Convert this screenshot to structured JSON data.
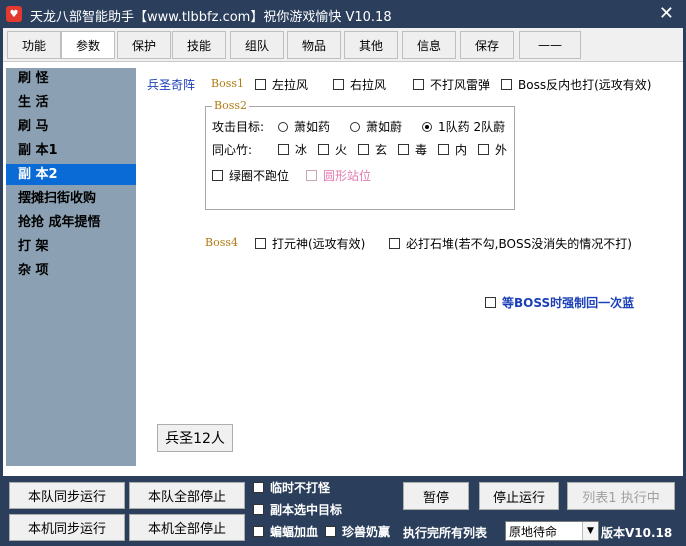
{
  "window": {
    "title": "天龙八部智能助手【www.tlbbfz.com】祝你游戏愉快 V10.18",
    "close_glyph": "✕"
  },
  "tabs": [
    {
      "label": "功能"
    },
    {
      "label": "参数"
    },
    {
      "label": "保护"
    },
    {
      "label": "技能"
    },
    {
      "label": "组队"
    },
    {
      "label": "物品"
    },
    {
      "label": "其他"
    },
    {
      "label": "信息"
    },
    {
      "label": "保存"
    },
    {
      "label": "——"
    }
  ],
  "sidebar": {
    "items": [
      {
        "label": "刷 怪"
      },
      {
        "label": "生 活"
      },
      {
        "label": "刷 马"
      },
      {
        "label": "副 本1"
      },
      {
        "label": "副 本2"
      },
      {
        "label": "摆摊扫街收购"
      },
      {
        "label": "抢抢 成年提悟"
      },
      {
        "label": "打 架"
      },
      {
        "label": "杂 项"
      }
    ]
  },
  "content": {
    "section_title": "兵圣奇阵",
    "boss1": {
      "label": "Boss1",
      "options": [
        {
          "label": "左拉风"
        },
        {
          "label": "右拉风"
        },
        {
          "label": "不打风雷弹"
        },
        {
          "label": "Boss反内也打(远攻有效)"
        }
      ]
    },
    "boss2": {
      "legend": "Boss2",
      "target_label": "攻击目标:",
      "targets": [
        {
          "label": "萧如药"
        },
        {
          "label": "萧如蔚"
        },
        {
          "label": "1队药 2队蔚"
        }
      ],
      "tongxin_label": "同心竹:",
      "tongxin": [
        {
          "label": "冰"
        },
        {
          "label": "火"
        },
        {
          "label": "玄"
        },
        {
          "label": "毒"
        },
        {
          "label": "内"
        },
        {
          "label": "外"
        }
      ],
      "extras": [
        {
          "label": "绿圈不跑位"
        },
        {
          "label": "圆形站位"
        }
      ]
    },
    "boss4": {
      "label": "Boss4",
      "options": [
        {
          "label": "打元神(远攻有效)"
        },
        {
          "label": "必打石堆(若不勾,BOSS没消失的情况不打)"
        }
      ]
    },
    "force_blue_label": "等BOSS时强制回一次蓝",
    "bingsheng_button": "兵圣12人"
  },
  "bottom": {
    "btn_team_sync": "本队同步运行",
    "btn_team_stop": "本队全部停止",
    "btn_local_sync": "本机同步运行",
    "btn_local_stop": "本机全部停止",
    "cb_temp_no_fight": "临时不打怪",
    "cb_dungeon_target": "副本选中目标",
    "cb_bat_blood": "蝙蝠加血",
    "cb_rare_beast": "珍兽奶赢",
    "btn_pause": "暂停",
    "btn_stop": "停止运行",
    "btn_list1": "列表1 执行中",
    "after_all_label": "执行完所有列表",
    "after_all_value": "原地待命",
    "version": "版本V10.18"
  },
  "colors": {
    "titlebar": "#2b3f5c",
    "sidebar": "#8ba1b3",
    "sidebar_active": "#0a6ad6",
    "boss_label": "#b07a12",
    "blue_text": "#1a3fb8",
    "pink_text": "#e07ab0"
  }
}
